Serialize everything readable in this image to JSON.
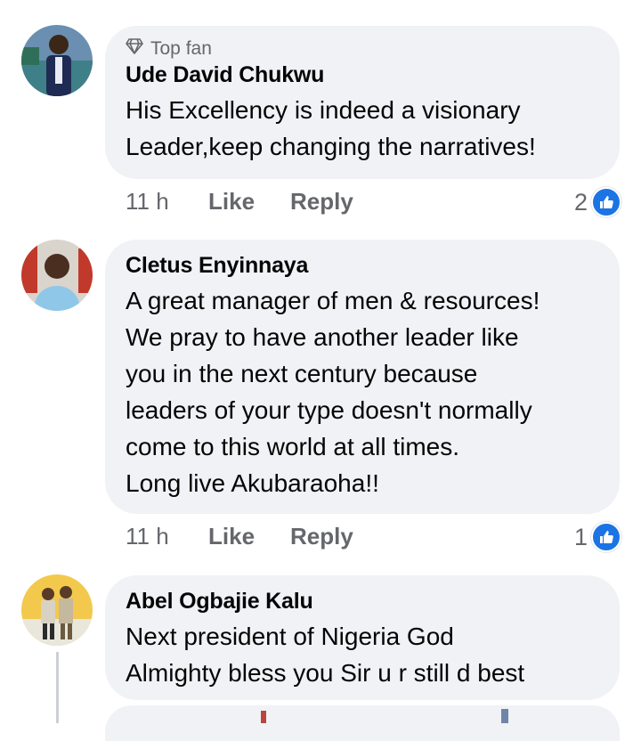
{
  "comments": [
    {
      "badge": "Top fan",
      "author": "Ude David Chukwu",
      "text": "His Excellency is indeed a visionary\nLeader,keep changing the narratives!",
      "time": "11 h",
      "like_label": "Like",
      "reply_label": "Reply",
      "reaction_count": "2"
    },
    {
      "author": "Cletus Enyinnaya",
      "text": "A great manager of men & resources!\nWe pray to have another leader like\nyou in the next century because\nleaders of your type doesn't normally\ncome to this world at all  times.\nLong live Akubaraoha!!",
      "time": "11 h",
      "like_label": "Like",
      "reply_label": "Reply",
      "reaction_count": "1"
    },
    {
      "author": "Abel Ogbajie Kalu",
      "text": "Next president of Nigeria God\nAlmighty bless you Sir u r still d best"
    }
  ],
  "colors": {
    "bubble": "#f0f2f5",
    "secondary_text": "#65676b",
    "like_blue": "#1b74e4"
  },
  "icons": [
    "diamond-icon",
    "thumbs-up-icon"
  ]
}
